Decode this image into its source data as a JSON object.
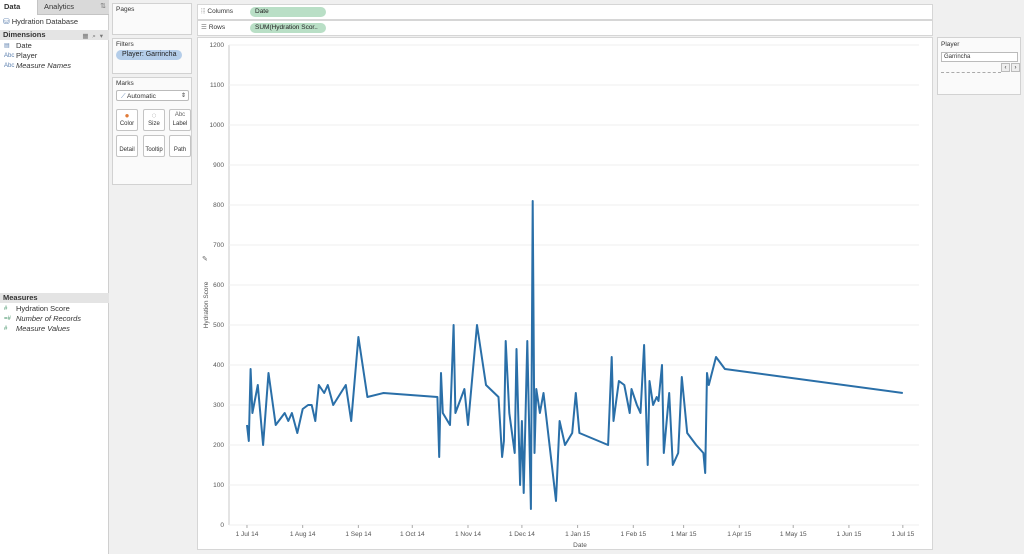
{
  "data_pane": {
    "tabs": [
      {
        "label": "Data"
      },
      {
        "label": "Analytics"
      }
    ],
    "datasource": "Hydration Database",
    "dimensions_header": "Dimensions",
    "dimensions": [
      {
        "label": "Date",
        "icon": "calendar-icon"
      },
      {
        "label": "Player",
        "icon": "abc-icon"
      },
      {
        "label": "Measure Names",
        "icon": "abc-icon"
      }
    ],
    "measures_header": "Measures",
    "measures": [
      {
        "label": "Hydration Score",
        "icon": "hash-icon"
      },
      {
        "label": "Number of Records",
        "icon": "hash-icon"
      },
      {
        "label": "Measure Values",
        "icon": "hash-icon"
      }
    ]
  },
  "pages": {
    "title": "Pages"
  },
  "filters": {
    "title": "Filters",
    "pill": "Player: Garrincha"
  },
  "marks": {
    "title": "Marks",
    "type": "Automatic",
    "buttons": [
      {
        "label": "Color"
      },
      {
        "label": "Size"
      },
      {
        "label": "Label"
      },
      {
        "label": "Detail"
      },
      {
        "label": "Tooltip"
      },
      {
        "label": "Path"
      }
    ]
  },
  "columns": {
    "label": "Columns",
    "pill": "Date"
  },
  "rows": {
    "label": "Rows",
    "pill": "SUM(Hydration Scor.."
  },
  "player_filter": {
    "title": "Player",
    "value": "Garrincha"
  },
  "chart_data": {
    "type": "line",
    "xlabel": "Date",
    "ylabel": "Hydration Score",
    "ylim": [
      0,
      1200
    ],
    "yticks": [
      0,
      100,
      200,
      300,
      400,
      500,
      600,
      700,
      800,
      900,
      1000,
      1100,
      1200
    ],
    "xticks": [
      "1 Jul 14",
      "1 Aug 14",
      "1 Sep 14",
      "1 Oct 14",
      "1 Nov 14",
      "1 Dec 14",
      "1 Jan 15",
      "1 Feb 15",
      "1 Mar 15",
      "1 Apr 15",
      "1 May 15",
      "1 Jun 15",
      "1 Jul 15"
    ],
    "grid": true,
    "color": "#2a6fa8",
    "series": [
      {
        "points": [
          [
            "2014-07-01",
            250
          ],
          [
            "2014-07-02",
            210
          ],
          [
            "2014-07-03",
            390
          ],
          [
            "2014-07-04",
            280
          ],
          [
            "2014-07-07",
            350
          ],
          [
            "2014-07-10",
            200
          ],
          [
            "2014-07-13",
            380
          ],
          [
            "2014-07-17",
            250
          ],
          [
            "2014-07-22",
            280
          ],
          [
            "2014-07-24",
            260
          ],
          [
            "2014-07-26",
            280
          ],
          [
            "2014-07-29",
            230
          ],
          [
            "2014-08-01",
            290
          ],
          [
            "2014-08-04",
            300
          ],
          [
            "2014-08-06",
            300
          ],
          [
            "2014-08-08",
            260
          ],
          [
            "2014-08-10",
            350
          ],
          [
            "2014-08-13",
            330
          ],
          [
            "2014-08-15",
            350
          ],
          [
            "2014-08-18",
            300
          ],
          [
            "2014-08-25",
            350
          ],
          [
            "2014-08-28",
            260
          ],
          [
            "2014-09-01",
            470
          ],
          [
            "2014-09-06",
            320
          ],
          [
            "2014-09-15",
            330
          ],
          [
            "2014-10-15",
            320
          ],
          [
            "2014-10-16",
            170
          ],
          [
            "2014-10-17",
            380
          ],
          [
            "2014-10-18",
            280
          ],
          [
            "2014-10-22",
            250
          ],
          [
            "2014-10-24",
            500
          ],
          [
            "2014-10-25",
            280
          ],
          [
            "2014-10-30",
            340
          ],
          [
            "2014-11-01",
            250
          ],
          [
            "2014-11-06",
            500
          ],
          [
            "2014-11-11",
            350
          ],
          [
            "2014-11-18",
            320
          ],
          [
            "2014-11-20",
            170
          ],
          [
            "2014-11-21",
            210
          ],
          [
            "2014-11-22",
            460
          ],
          [
            "2014-11-24",
            280
          ],
          [
            "2014-11-27",
            180
          ],
          [
            "2014-11-28",
            440
          ],
          [
            "2014-11-30",
            100
          ],
          [
            "2014-12-01",
            260
          ],
          [
            "2014-12-02",
            80
          ],
          [
            "2014-12-04",
            460
          ],
          [
            "2014-12-06",
            40
          ],
          [
            "2014-12-07",
            810
          ],
          [
            "2014-12-08",
            180
          ],
          [
            "2014-12-09",
            340
          ],
          [
            "2014-12-11",
            280
          ],
          [
            "2014-12-13",
            330
          ],
          [
            "2014-12-20",
            60
          ],
          [
            "2014-12-22",
            260
          ],
          [
            "2014-12-25",
            200
          ],
          [
            "2014-12-29",
            230
          ],
          [
            "2014-12-31",
            330
          ],
          [
            "2015-01-02",
            230
          ],
          [
            "2015-01-18",
            200
          ],
          [
            "2015-01-20",
            420
          ],
          [
            "2015-01-21",
            260
          ],
          [
            "2015-01-24",
            360
          ],
          [
            "2015-01-27",
            350
          ],
          [
            "2015-01-30",
            280
          ],
          [
            "2015-01-31",
            340
          ],
          [
            "2015-02-03",
            300
          ],
          [
            "2015-02-05",
            280
          ],
          [
            "2015-02-07",
            450
          ],
          [
            "2015-02-09",
            150
          ],
          [
            "2015-02-10",
            360
          ],
          [
            "2015-02-12",
            300
          ],
          [
            "2015-02-14",
            320
          ],
          [
            "2015-02-15",
            310
          ],
          [
            "2015-02-17",
            400
          ],
          [
            "2015-02-18",
            180
          ],
          [
            "2015-02-21",
            330
          ],
          [
            "2015-02-23",
            150
          ],
          [
            "2015-02-26",
            180
          ],
          [
            "2015-02-28",
            370
          ],
          [
            "2015-03-03",
            230
          ],
          [
            "2015-03-08",
            200
          ],
          [
            "2015-03-12",
            180
          ],
          [
            "2015-03-13",
            130
          ],
          [
            "2015-03-14",
            380
          ],
          [
            "2015-03-15",
            350
          ],
          [
            "2015-03-19",
            420
          ],
          [
            "2015-03-24",
            390
          ],
          [
            "2015-07-01",
            330
          ]
        ]
      }
    ]
  }
}
